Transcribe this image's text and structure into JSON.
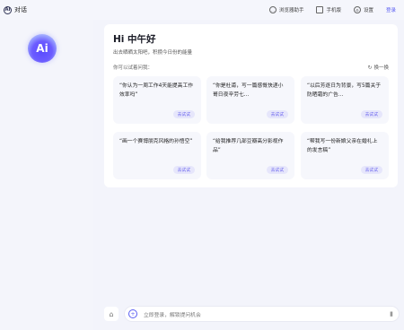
{
  "app": {
    "name": "对话",
    "logo_text": "AI"
  },
  "header": {
    "browser_assistant": "浏览器助手",
    "mobile": "手机版",
    "settings": "设置",
    "login": "登录"
  },
  "sidebar": {
    "avatar_text": "Ai"
  },
  "main": {
    "greeting": "Hi 中午好",
    "subtitle": "出去晒晒太阳吧，积攒今日份的能量",
    "ask_label": "你可以试着问我：",
    "refresh_label": "换一换",
    "prompts": [
      {
        "text": "“你认为一周工作4天能提高工作效率吗”",
        "try_label": "去试试"
      },
      {
        "text": "“你是杜甫，写一篇感慨快递小哥日夜辛劳七...",
        "try_label": "去试试"
      },
      {
        "text": "“以后芳逐日为背景，写5篇关于防晒霜的广告...",
        "try_label": "去试试"
      },
      {
        "text": "“画一个赛博朋克风格的孙悟空”",
        "try_label": "去试试"
      },
      {
        "text": "“给我推荐几部豆瓣高分影视作品”",
        "try_label": "去试试"
      },
      {
        "text": "“帮我写一份新娘父亲在婚礼上的发言稿”",
        "try_label": "去试试"
      }
    ]
  },
  "input": {
    "placeholder": "立即登录，解锁提问机会"
  },
  "icons": {
    "brand": "ai-logo-icon",
    "browser_assistant": "chat-bubble-icon",
    "mobile": "phone-icon",
    "settings": "gear-icon",
    "refresh": "refresh-icon",
    "store": "store-icon",
    "plus": "plus-icon",
    "mic": "microphone-icon"
  },
  "colors": {
    "accent": "#5b5ff2",
    "background": "#f3f4fb"
  }
}
